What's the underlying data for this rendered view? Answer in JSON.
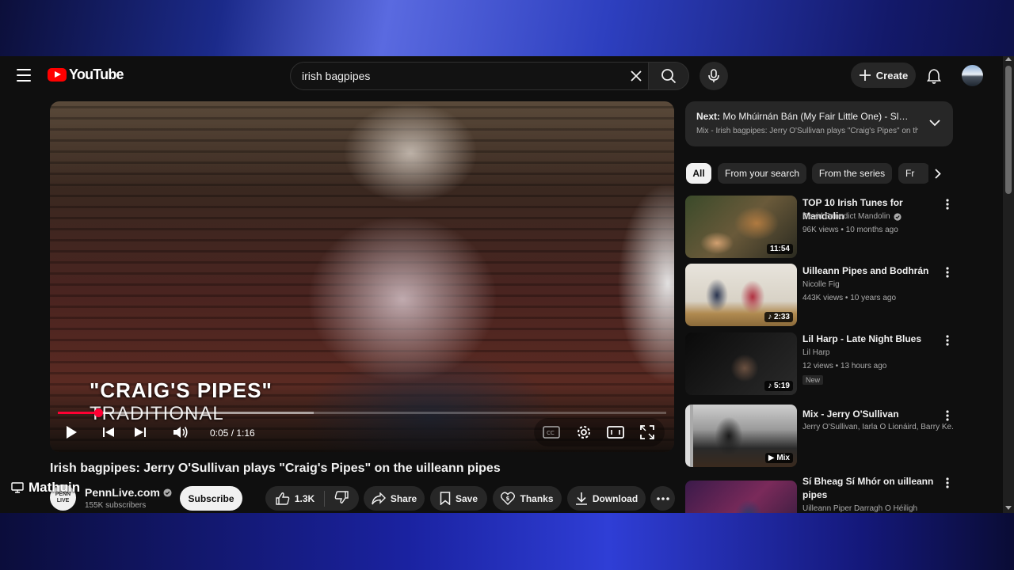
{
  "header": {
    "logo_text": "YouTube",
    "search_value": "irish bagpipes",
    "create_label": "Create"
  },
  "player": {
    "overlay_title": "\"CRAIG'S PIPES\"",
    "overlay_subtitle": "TRADITIONAL",
    "time": "0:05 / 1:16",
    "progress": 0.066,
    "buffered": 0.42
  },
  "video": {
    "title": "Irish bagpipes: Jerry O'Sullivan plays \"Craig's Pipes\" on the uilleann pipes",
    "channel": "PennLive.com",
    "channel_avatar_text": "PENN LIVE",
    "subscribers": "155K subscribers",
    "subscribe_label": "Subscribe",
    "likes": "1.3K",
    "share_label": "Share",
    "save_label": "Save",
    "thanks_label": "Thanks",
    "download_label": "Download"
  },
  "cast": {
    "label": "Mathuin"
  },
  "up_next": {
    "prefix": "Next:",
    "title": "Mo Mhúirnán Bán (My Fair Little One) - Slow ...",
    "subtitle": "Mix - Irish bagpipes: Jerry O'Sullivan plays \"Craig's Pipes\" on th"
  },
  "chips": [
    "All",
    "From your search",
    "From the series",
    "Fr"
  ],
  "recommendations": [
    {
      "title": "TOP 10 Irish Tunes for Mandolin",
      "channel": "David Benedict Mandolin",
      "verified": true,
      "meta": "96K views • 10 months ago",
      "duration": "11:54",
      "badge": ""
    },
    {
      "title": "Uilleann Pipes and Bodhrán",
      "channel": "Nicolle Fig",
      "verified": false,
      "meta": "443K views • 10 years ago",
      "duration": "♪ 2:33",
      "badge": ""
    },
    {
      "title": "Lil Harp - Late Night Blues",
      "channel": "Lil Harp",
      "verified": false,
      "meta": "12 views • 13 hours ago",
      "duration": "♪ 5:19",
      "badge": "New"
    },
    {
      "title": "Mix - Jerry O'Sullivan",
      "channel": "Jerry O'Sullivan, Iarla Ó Lionáird, Barry Ke...",
      "verified": false,
      "meta": "",
      "duration": "Mix",
      "badge": ""
    },
    {
      "title": "Sí Bheag Sí Mhór on uilleann pipes",
      "channel": "Uilleann Piper Darragh Ó Héiligh",
      "verified": false,
      "meta": "",
      "duration": "",
      "badge": ""
    }
  ],
  "colors": {
    "background": "#0f0f0f",
    "accent_red": "#ff0033",
    "chip_bg": "#272727"
  }
}
